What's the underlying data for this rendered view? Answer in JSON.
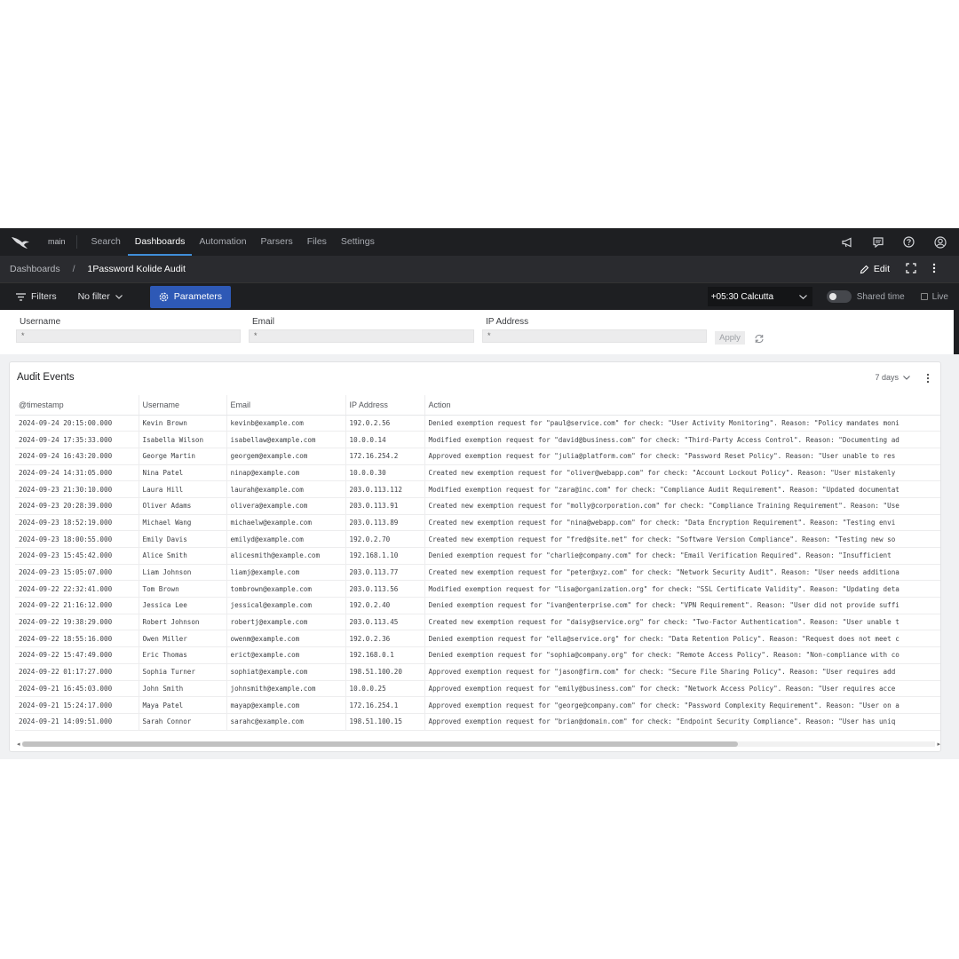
{
  "nav": {
    "repo": "main",
    "items": [
      "Search",
      "Dashboards",
      "Automation",
      "Parsers",
      "Files",
      "Settings"
    ],
    "active": "Dashboards"
  },
  "breadcrumb": {
    "parent": "Dashboards",
    "separator": "/",
    "current": "1Password Kolide Audit",
    "edit_label": "Edit"
  },
  "filterbar": {
    "filters_label": "Filters",
    "filter_value": "No filter",
    "parameters_label": "Parameters",
    "timezone": "+05:30 Calcutta",
    "shared_time_label": "Shared time",
    "live_label": "Live"
  },
  "parameters": [
    {
      "label": "Username",
      "value": "*"
    },
    {
      "label": "Email",
      "value": "*"
    },
    {
      "label": "IP Address",
      "value": "*"
    }
  ],
  "apply_label": "Apply",
  "widget": {
    "title": "Audit Events",
    "time_range": "7 days",
    "columns": [
      "@timestamp",
      "Username",
      "Email",
      "IP Address",
      "Action"
    ],
    "rows": [
      [
        "2024-09-24 20:15:00.000",
        "Kevin Brown",
        "kevinb@example.com",
        "192.0.2.56",
        "Denied exemption request for \"paul@service.com\" for check: \"User Activity Monitoring\". Reason: \"Policy mandates moni"
      ],
      [
        "2024-09-24 17:35:33.000",
        "Isabella Wilson",
        "isabellaw@example.com",
        "10.0.0.14",
        "Modified exemption request for \"david@business.com\" for check: \"Third-Party Access Control\". Reason: \"Documenting ad"
      ],
      [
        "2024-09-24 16:43:20.000",
        "George Martin",
        "georgem@example.com",
        "172.16.254.2",
        "Approved exemption request for \"julia@platform.com\" for check: \"Password Reset Policy\". Reason: \"User unable to res"
      ],
      [
        "2024-09-24 14:31:05.000",
        "Nina Patel",
        "ninap@example.com",
        "10.0.0.30",
        "Created new exemption request for \"oliver@webapp.com\" for check: \"Account Lockout Policy\". Reason: \"User mistakenly"
      ],
      [
        "2024-09-23 21:30:10.000",
        "Laura Hill",
        "laurah@example.com",
        "203.0.113.112",
        "Modified exemption request for \"zara@inc.com\" for check: \"Compliance Audit Requirement\". Reason: \"Updated documentat"
      ],
      [
        "2024-09-23 20:28:39.000",
        "Oliver Adams",
        "olivera@example.com",
        "203.0.113.91",
        "Created new exemption request for \"molly@corporation.com\" for check: \"Compliance Training Requirement\". Reason: \"Use"
      ],
      [
        "2024-09-23 18:52:19.000",
        "Michael Wang",
        "michaelw@example.com",
        "203.0.113.89",
        "Created new exemption request for \"nina@webapp.com\" for check: \"Data Encryption Requirement\". Reason: \"Testing envi"
      ],
      [
        "2024-09-23 18:00:55.000",
        "Emily Davis",
        "emilyd@example.com",
        "192.0.2.70",
        "Created new exemption request for \"fred@site.net\" for check: \"Software Version Compliance\". Reason: \"Testing new so"
      ],
      [
        "2024-09-23 15:45:42.000",
        "Alice Smith",
        "alicesmith@example.com",
        "192.168.1.10",
        "Denied exemption request for \"charlie@company.com\" for check: \"Email Verification Required\". Reason: \"Insufficient"
      ],
      [
        "2024-09-23 15:05:07.000",
        "Liam Johnson",
        "liamj@example.com",
        "203.0.113.77",
        "Created new exemption request for \"peter@xyz.com\" for check: \"Network Security Audit\". Reason: \"User needs additiona"
      ],
      [
        "2024-09-22 22:32:41.000",
        "Tom Brown",
        "tombrown@example.com",
        "203.0.113.56",
        "Modified exemption request for \"lisa@organization.org\" for check: \"SSL Certificate Validity\". Reason: \"Updating deta"
      ],
      [
        "2024-09-22 21:16:12.000",
        "Jessica Lee",
        "jessical@example.com",
        "192.0.2.40",
        "Denied exemption request for \"ivan@enterprise.com\" for check: \"VPN Requirement\". Reason: \"User did not provide suffi"
      ],
      [
        "2024-09-22 19:38:29.000",
        "Robert Johnson",
        "robertj@example.com",
        "203.0.113.45",
        "Created new exemption request for \"daisy@service.org\" for check: \"Two-Factor Authentication\". Reason: \"User unable t"
      ],
      [
        "2024-09-22 18:55:16.000",
        "Owen Miller",
        "owenm@example.com",
        "192.0.2.36",
        "Denied exemption request for \"ella@service.org\" for check: \"Data Retention Policy\". Reason: \"Request does not meet c"
      ],
      [
        "2024-09-22 15:47:49.000",
        "Eric Thomas",
        "erict@example.com",
        "192.168.0.1",
        "Denied exemption request for \"sophia@company.org\" for check: \"Remote Access Policy\". Reason: \"Non-compliance with co"
      ],
      [
        "2024-09-22 01:17:27.000",
        "Sophia Turner",
        "sophiat@example.com",
        "198.51.100.20",
        "Approved exemption request for \"jason@firm.com\" for check: \"Secure File Sharing Policy\". Reason: \"User requires add"
      ],
      [
        "2024-09-21 16:45:03.000",
        "John Smith",
        "johnsmith@example.com",
        "10.0.0.25",
        "Approved exemption request for \"emily@business.com\" for check: \"Network Access Policy\". Reason: \"User requires acce"
      ],
      [
        "2024-09-21 15:24:17.000",
        "Maya Patel",
        "mayap@example.com",
        "172.16.254.1",
        "Approved exemption request for \"george@company.com\" for check: \"Password Complexity Requirement\". Reason: \"User on a"
      ],
      [
        "2024-09-21 14:09:51.000",
        "Sarah Connor",
        "sarahc@example.com",
        "198.51.100.15",
        "Approved exemption request for \"brian@domain.com\" for check: \"Endpoint Security Compliance\". Reason: \"User has uniq"
      ]
    ]
  }
}
